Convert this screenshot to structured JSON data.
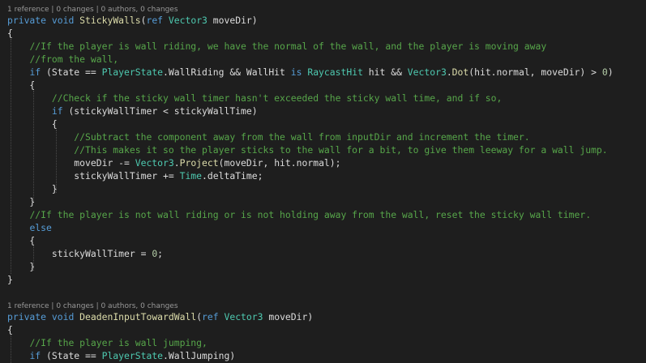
{
  "theme": {
    "background": "#1e1e1e",
    "text": "#dcdcdc",
    "keyword": "#569cd6",
    "type": "#4ec9b0",
    "method": "#dcdcaa",
    "comment": "#57a64a",
    "number": "#b5cea8",
    "codelens": "#999999"
  },
  "codelens": {
    "first": "1 reference | 0 changes | 0 authors, 0 changes",
    "second": "1 reference | 0 changes | 0 authors, 0 changes"
  },
  "code": {
    "l1": {
      "a": "private",
      "b": " ",
      "c": "void",
      "d": " ",
      "e": "StickyWalls",
      "f": "(",
      "g": "ref",
      "h": " ",
      "i": "Vector3",
      "j": " moveDir)"
    },
    "l2": {
      "a": "{"
    },
    "l3": {
      "a": "    ",
      "b": "//If the player is wall riding, we have the normal of the wall, and the player is moving away"
    },
    "l4": {
      "a": "    ",
      "b": "//from the wall,"
    },
    "l5": {
      "a": "    ",
      "b": "if",
      "c": " (State == ",
      "d": "PlayerState",
      "e": ".WallRiding && WallHit ",
      "f": "is",
      "g": " ",
      "h": "RaycastHit",
      "i": " hit && ",
      "j": "Vector3",
      "k": ".",
      "l": "Dot",
      "m": "(hit.normal, moveDir) > ",
      "n": "0",
      "o": ")"
    },
    "l6": {
      "a": "    {"
    },
    "l7": {
      "a": "        ",
      "b": "//Check if the sticky wall timer hasn't exceeded the sticky wall time, and if so,"
    },
    "l8": {
      "a": "        ",
      "b": "if",
      "c": " (stickyWallTimer < stickyWallTime)"
    },
    "l9": {
      "a": "        {"
    },
    "l10": {
      "a": "            ",
      "b": "//Subtract the component away from the wall from inputDir and increment the timer."
    },
    "l11": {
      "a": "            ",
      "b": "//This makes it so the player sticks to the wall for a bit, to give them leeway for a wall jump."
    },
    "l12": {
      "a": "            moveDir -= ",
      "b": "Vector3",
      "c": ".",
      "d": "Project",
      "e": "(moveDir, hit.normal);"
    },
    "l13": {
      "a": "            stickyWallTimer += ",
      "b": "Time",
      "c": ".deltaTime;"
    },
    "l14": {
      "a": "        }"
    },
    "l15": {
      "a": "    }"
    },
    "l16": {
      "a": "    ",
      "b": "//If the player is not wall riding or is not holding away from the wall, reset the sticky wall timer."
    },
    "l17": {
      "a": "    ",
      "b": "else"
    },
    "l18": {
      "a": "    {"
    },
    "l19": {
      "a": "        stickyWallTimer = ",
      "b": "0",
      "c": ";"
    },
    "l20": {
      "a": "    }"
    },
    "l21": {
      "a": "}"
    },
    "l22": {
      "a": ""
    },
    "l23": {
      "a": "private",
      "b": " ",
      "c": "void",
      "d": " ",
      "e": "DeadenInputTowardWall",
      "f": "(",
      "g": "ref",
      "h": " ",
      "i": "Vector3",
      "j": " moveDir)"
    },
    "l24": {
      "a": "{"
    },
    "l25": {
      "a": "    ",
      "b": "//If the player is wall jumping,"
    },
    "l26": {
      "a": "    ",
      "b": "if",
      "c": " (State == ",
      "d": "PlayerState",
      "e": ".WallJumping)"
    }
  }
}
